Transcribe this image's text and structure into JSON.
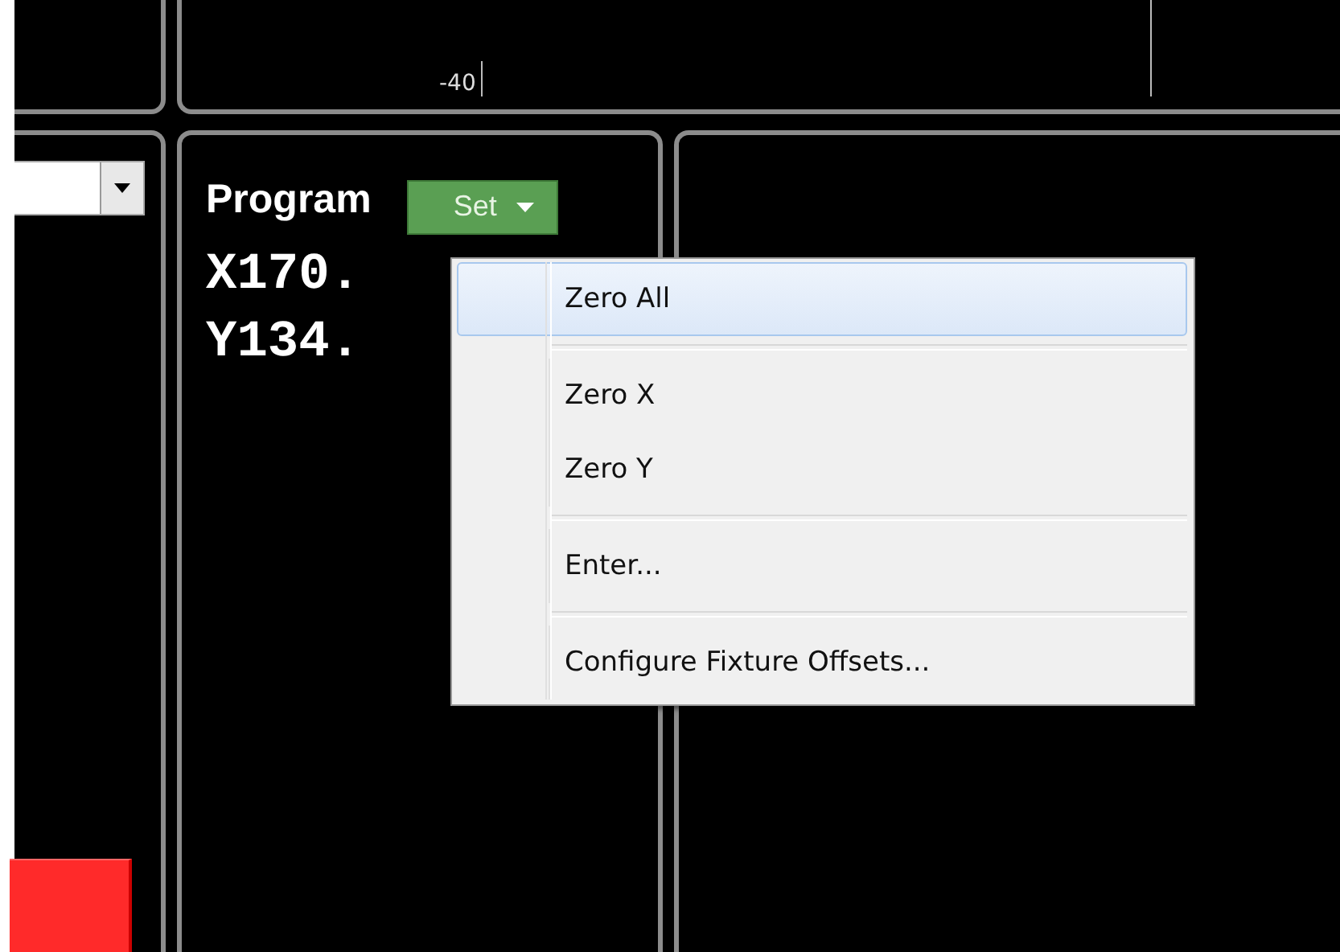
{
  "scale": {
    "label": "-40"
  },
  "program_panel": {
    "title": "Program",
    "set_button": "Set",
    "coordinates": [
      "X170.",
      "Y134."
    ]
  },
  "menu": {
    "groups": [
      {
        "items": [
          {
            "label": "Zero All",
            "selected": true
          }
        ]
      },
      {
        "items": [
          {
            "label": "Zero X",
            "selected": false
          },
          {
            "label": "Zero Y",
            "selected": false
          }
        ]
      },
      {
        "items": [
          {
            "label": "Enter...",
            "selected": false
          }
        ]
      },
      {
        "items": [
          {
            "label": "Configure Fixture Offsets...",
            "selected": false
          }
        ]
      }
    ]
  }
}
